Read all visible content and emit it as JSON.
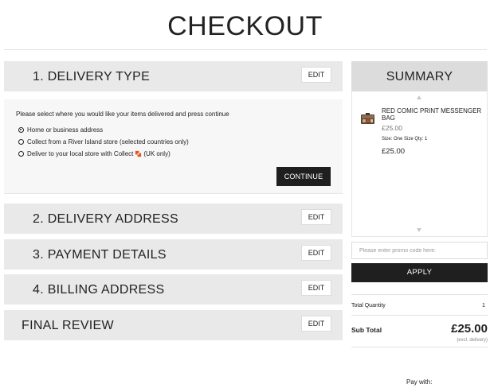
{
  "page": {
    "title": "CHECKOUT"
  },
  "sections": [
    {
      "label": "1.  DELIVERY TYPE",
      "edit": "EDIT"
    },
    {
      "label": "2.  DELIVERY ADDRESS",
      "edit": "EDIT"
    },
    {
      "label": "3.  PAYMENT DETAILS",
      "edit": "EDIT"
    },
    {
      "label": "4.  BILLING ADDRESS",
      "edit": "EDIT"
    },
    {
      "label": "FINAL REVIEW",
      "edit": "EDIT"
    }
  ],
  "delivery": {
    "instruction": "Please select where you would like your items delivered and press continue",
    "options": [
      {
        "label": "Home or business address",
        "selected": true
      },
      {
        "label": "Collect from a River Island store (selected countries only)",
        "selected": false
      },
      {
        "label_before": "Deliver to your local store with Collect",
        "label_after": "(UK only)",
        "selected": false
      }
    ],
    "continue_label": "CONTINUE"
  },
  "summary": {
    "title": "SUMMARY",
    "product": {
      "name": "RED COMIC PRINT MESSENGER BAG",
      "price_grey": "£25.00",
      "meta": "Size: One Size   Qty: 1",
      "price": "£25.00"
    },
    "promo_placeholder": "Please enter promo code here:",
    "apply_label": "APPLY",
    "total_quantity_label": "Total Quantity",
    "total_quantity_value": "1",
    "subtotal_label": "Sub Total",
    "subtotal_value": "£25.00",
    "subtotal_note": "(excl. delivery)",
    "pay_with": "Pay with:"
  },
  "colors": {
    "accent": "#1f1f1f",
    "section_bg": "#e9e9e9",
    "collect_icon": "#e8501e"
  }
}
